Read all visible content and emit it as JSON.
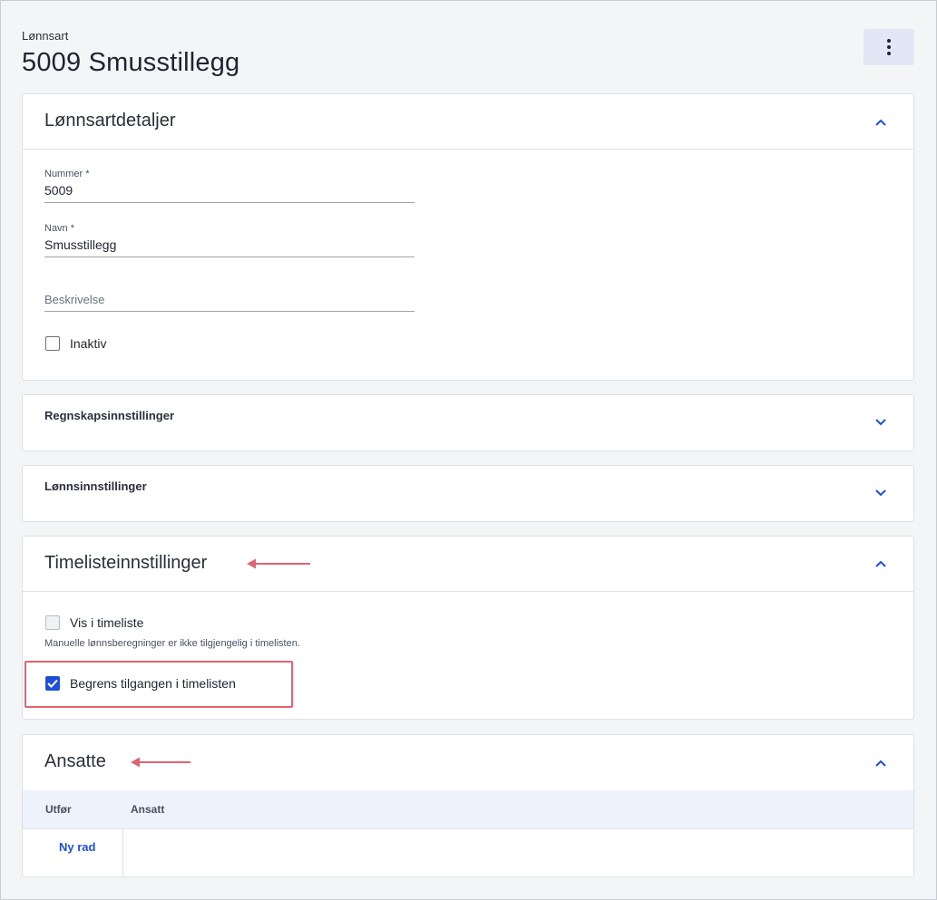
{
  "page": {
    "subtitle": "Lønnsart",
    "title": "5009 Smusstillegg"
  },
  "sections": {
    "details": {
      "title": "Lønnsartdetaljer",
      "nummer_label": "Nummer *",
      "nummer_value": "5009",
      "navn_label": "Navn *",
      "navn_value": "Smusstillegg",
      "beskrivelse_placeholder": "Beskrivelse",
      "inaktiv_label": "Inaktiv",
      "inaktiv_checked": false
    },
    "accounting": {
      "title": "Regnskapsinnstillinger"
    },
    "salary": {
      "title": "Lønnsinnstillinger"
    },
    "timesheet": {
      "title": "Timelisteinnstillinger",
      "vis_label": "Vis i timeliste",
      "vis_helper": "Manuelle lønnsberegninger er ikke tilgjengelig i timelisten.",
      "begrens_label": "Begrens tilgangen i timelisten",
      "begrens_checked": true
    },
    "employees": {
      "title": "Ansatte",
      "columns": [
        "Utfør",
        "Ansatt"
      ],
      "new_row_label": "Ny rad"
    }
  },
  "colors": {
    "accent": "#1f4fd8",
    "annotation": "#e06470"
  }
}
